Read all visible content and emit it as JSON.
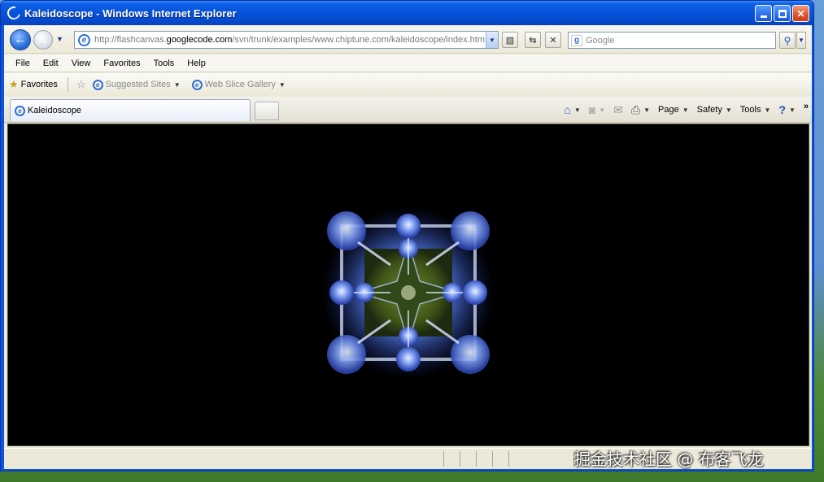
{
  "window": {
    "title": "Kaleidoscope - Windows Internet Explorer"
  },
  "address": {
    "url_prefix": "http://flashcanvas.",
    "url_host": "googlecode.com",
    "url_suffix": "/svn/trunk/examples/www.chiptune.com/kaleidoscope/index.htm"
  },
  "search": {
    "placeholder": "Google"
  },
  "menu": [
    "File",
    "Edit",
    "View",
    "Favorites",
    "Tools",
    "Help"
  ],
  "favorites": {
    "label": "Favorites",
    "links": [
      "Suggested Sites",
      "Web Slice Gallery"
    ]
  },
  "tabs": [
    {
      "label": "Kaleidoscope",
      "active": true
    }
  ],
  "commands": [
    "Page",
    "Safety",
    "Tools"
  ],
  "watermark": "掘金技术社区 @ 布客飞龙",
  "colors": {
    "title_bar": "#0653d8",
    "chrome": "#ece9d8",
    "viewport": "#000000",
    "kaleido_glow": "#5a7fe0",
    "kaleido_center": "#4f6a1c"
  }
}
